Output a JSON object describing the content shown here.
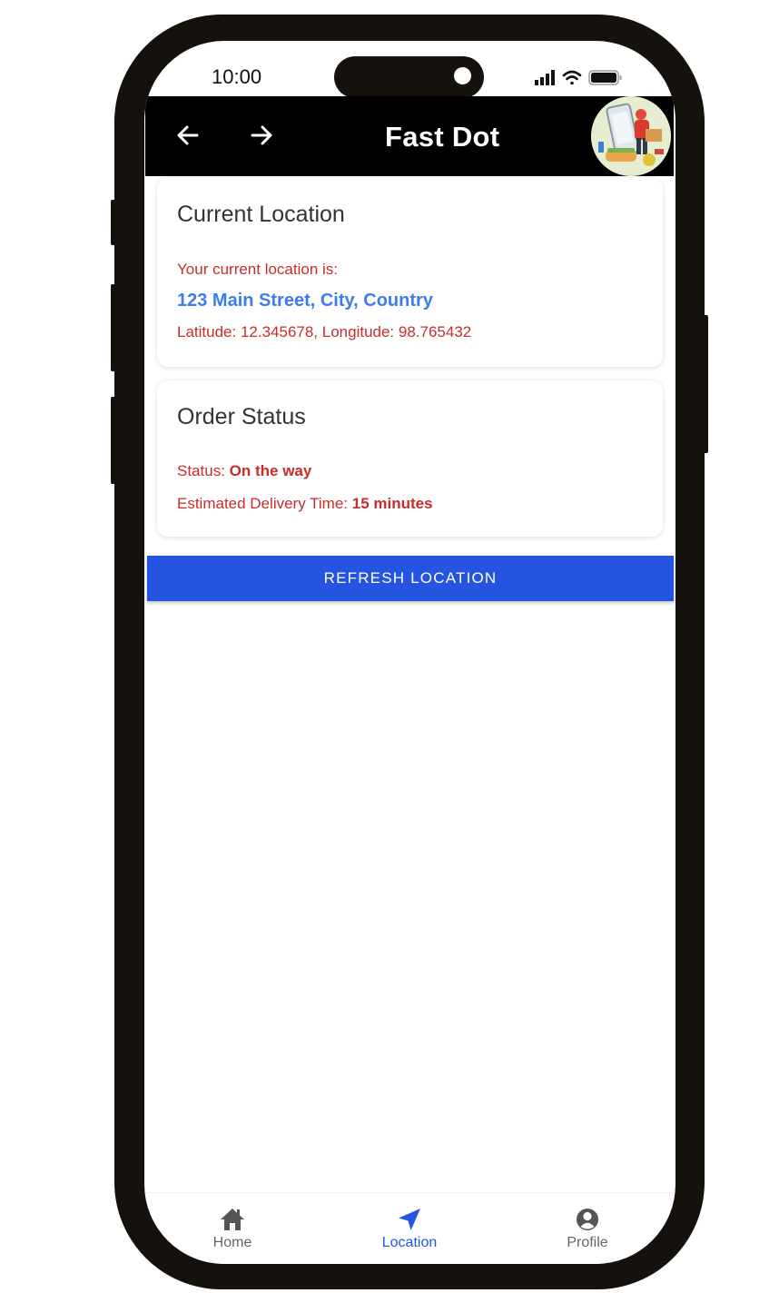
{
  "status_bar": {
    "time": "10:00"
  },
  "app_bar": {
    "title": "Fast Dot",
    "back_icon": "arrow-left-icon",
    "forward_icon": "arrow-right-icon",
    "logo_icon": "delivery-logo"
  },
  "current_location": {
    "title": "Current Location",
    "intro": "Your current location is:",
    "address": "123 Main Street, City, Country",
    "coords": "Latitude: 12.345678, Longitude: 98.765432"
  },
  "order_status": {
    "title": "Order Status",
    "status_label": "Status: ",
    "status_value": "On the way",
    "eta_label": "Estimated Delivery Time: ",
    "eta_value": "15 minutes"
  },
  "refresh_button": {
    "label": "REFRESH LOCATION"
  },
  "bottom_nav": {
    "items": [
      {
        "label": "Home",
        "icon": "home-icon",
        "active": false
      },
      {
        "label": "Location",
        "icon": "navigation-arrow-icon",
        "active": true
      },
      {
        "label": "Profile",
        "icon": "profile-icon",
        "active": false
      }
    ]
  },
  "colors": {
    "accent": "#2555e0",
    "address_blue": "#3c7ee9",
    "alert_red": "#c62d2d",
    "app_bar": "#000000"
  }
}
